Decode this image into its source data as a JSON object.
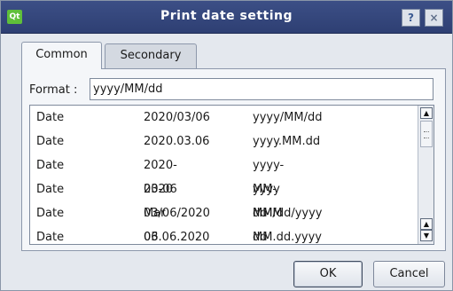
{
  "window": {
    "title": "Print date setting",
    "app_icon_text": "Qt",
    "help_label": "?",
    "close_label": "×"
  },
  "tabs": [
    {
      "label": "Common",
      "active": true
    },
    {
      "label": "Secondary",
      "active": false
    }
  ],
  "format": {
    "label": "Format :",
    "value": "yyyy/MM/dd"
  },
  "list": {
    "rows": [
      {
        "type": "Date",
        "example": "2020/03/06",
        "pattern": "yyyy/MM/dd"
      },
      {
        "type": "Date",
        "example": "2020.03.06",
        "pattern": "yyyy.MM.dd"
      },
      {
        "type": "Date",
        "example": "2020-03-06",
        "pattern": "yyyy-MM-dd"
      },
      {
        "type": "Date",
        "example": "2020 Mar 06",
        "pattern": "yyyy MMM dd"
      },
      {
        "type": "Date",
        "example": "03/06/2020",
        "pattern": "MM/dd/yyyy"
      },
      {
        "type": "Date",
        "example": "03.06.2020",
        "pattern": "MM.dd.yyyy"
      }
    ]
  },
  "buttons": {
    "ok": "OK",
    "cancel": "Cancel"
  },
  "icons": {
    "up": "scroll-up-arrow",
    "down": "scroll-down-arrow"
  }
}
